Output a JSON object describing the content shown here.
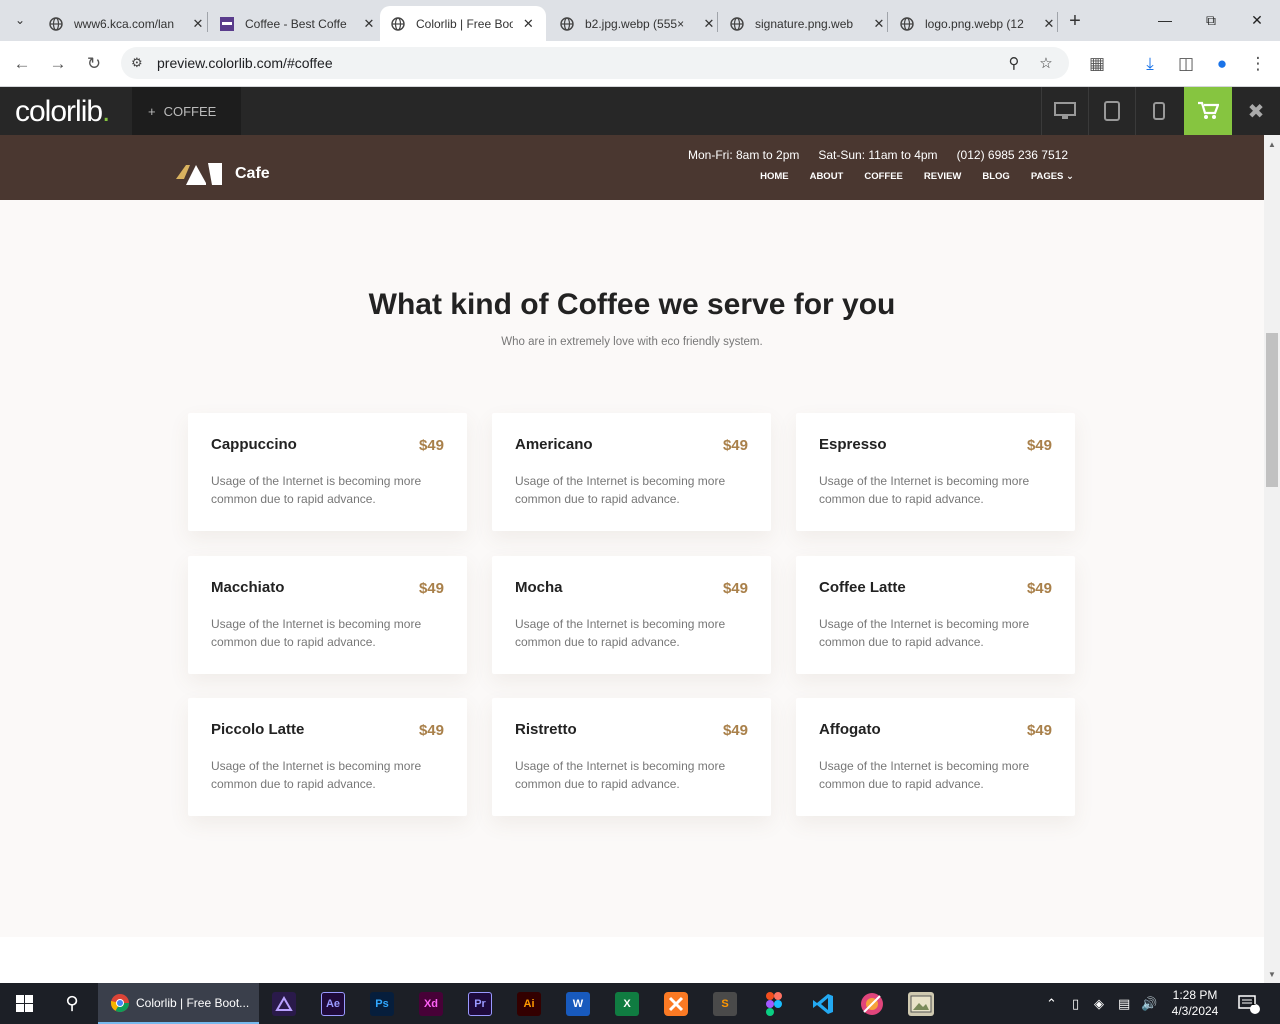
{
  "browser": {
    "tabs": [
      {
        "title": "www6.kca.com/lan",
        "active": false
      },
      {
        "title": "Coffee - Best Coffe",
        "active": false
      },
      {
        "title": "Colorlib | Free Boo",
        "active": true
      },
      {
        "title": "b2.jpg.webp (555×",
        "active": false
      },
      {
        "title": "signature.png.web",
        "active": false
      },
      {
        "title": "logo.png.webp (12",
        "active": false
      }
    ],
    "url": "preview.colorlib.com/#coffee"
  },
  "colorlib_bar": {
    "logo": "colorlib",
    "logo_dot": ".",
    "theme_label": "COFFEE",
    "accent": "#86c540"
  },
  "site": {
    "brand": "Cafe",
    "hours_weekday": "Mon-Fri: 8am to 2pm",
    "hours_weekend": "Sat-Sun: 11am to 4pm",
    "phone": "(012) 6985 236 7512",
    "nav": [
      "HOME",
      "ABOUT",
      "COFFEE",
      "REVIEW",
      "BLOG",
      "PAGES"
    ],
    "header_color": "#4a3730",
    "price_color": "#a9804a"
  },
  "section": {
    "title": "What kind of Coffee we serve for you",
    "subtitle": "Who are in extremely love with eco friendly system."
  },
  "menu": [
    {
      "name": "Cappuccino",
      "price": "$49",
      "desc": "Usage of the Internet is becoming more common due to rapid advance."
    },
    {
      "name": "Americano",
      "price": "$49",
      "desc": "Usage of the Internet is becoming more common due to rapid advance."
    },
    {
      "name": "Espresso",
      "price": "$49",
      "desc": "Usage of the Internet is becoming more common due to rapid advance."
    },
    {
      "name": "Macchiato",
      "price": "$49",
      "desc": "Usage of the Internet is becoming more common due to rapid advance."
    },
    {
      "name": "Mocha",
      "price": "$49",
      "desc": "Usage of the Internet is becoming more common due to rapid advance."
    },
    {
      "name": "Coffee Latte",
      "price": "$49",
      "desc": "Usage of the Internet is becoming more common due to rapid advance."
    },
    {
      "name": "Piccolo Latte",
      "price": "$49",
      "desc": "Usage of the Internet is becoming more common due to rapid advance."
    },
    {
      "name": "Ristretto",
      "price": "$49",
      "desc": "Usage of the Internet is becoming more common due to rapid advance."
    },
    {
      "name": "Affogato",
      "price": "$49",
      "desc": "Usage of the Internet is becoming more common due to rapid advance."
    }
  ],
  "taskbar": {
    "active_window": "Colorlib | Free Boot...",
    "apps": [
      {
        "icon": "premiere-rush-icon",
        "label": "",
        "bg": "#2a1a4a",
        "fg": "#b9a2ff"
      },
      {
        "icon": "after-effects-icon",
        "label": "Ae",
        "bg": "#1f0a3a",
        "fg": "#9a9aff"
      },
      {
        "icon": "photoshop-icon",
        "label": "Ps",
        "bg": "#061e3c",
        "fg": "#31a8ff"
      },
      {
        "icon": "xd-icon",
        "label": "Xd",
        "bg": "#470137",
        "fg": "#ff61f6"
      },
      {
        "icon": "premiere-icon",
        "label": "Pr",
        "bg": "#1e0a3c",
        "fg": "#9999ff"
      },
      {
        "icon": "illustrator-icon",
        "label": "Ai",
        "bg": "#330000",
        "fg": "#ff9a00"
      },
      {
        "icon": "word-icon",
        "label": "W",
        "bg": "#185abd",
        "fg": "#ffffff"
      },
      {
        "icon": "excel-icon",
        "label": "X",
        "bg": "#107c41",
        "fg": "#ffffff"
      },
      {
        "icon": "xampp-icon",
        "label": "",
        "bg": "#fb7a24",
        "fg": "#ffffff"
      },
      {
        "icon": "sublime-icon",
        "label": "S",
        "bg": "#4a4a4a",
        "fg": "#ff9800"
      },
      {
        "icon": "figma-icon",
        "label": "",
        "bg": "#1c1f26",
        "fg": "#ffffff"
      },
      {
        "icon": "vscode-icon",
        "label": "",
        "bg": "#1c1f26",
        "fg": "#23a9f2"
      },
      {
        "icon": "browser-icon",
        "label": "",
        "bg": "#e0457b",
        "fg": "#ffffff"
      },
      {
        "icon": "image-viewer-icon",
        "label": "",
        "bg": "#cfc9b0",
        "fg": "#333333"
      }
    ],
    "time": "1:28 PM",
    "date": "4/3/2024",
    "notification_count": "1"
  }
}
